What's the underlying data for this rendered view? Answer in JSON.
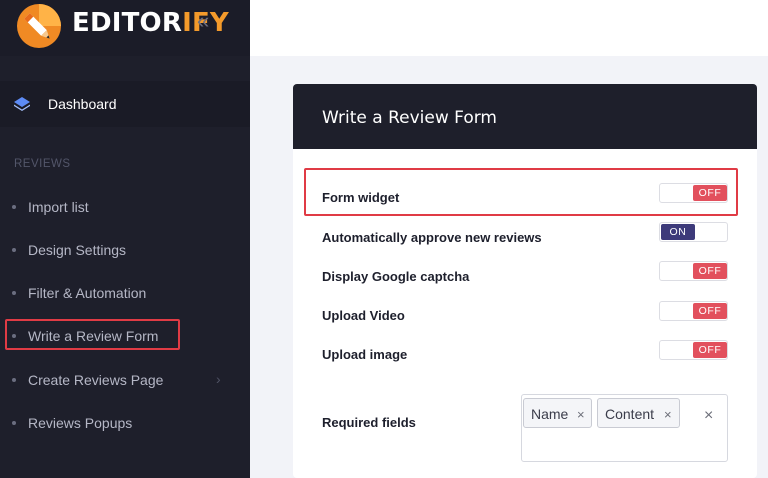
{
  "brand": {
    "name_main": "EDITOR",
    "name_accent": "IFY",
    "collapse_icon": "chevrons-left-icon",
    "accent_color": "#f39a2b"
  },
  "sidebar": {
    "dashboard_label": "Dashboard",
    "section_title": "REVIEWS",
    "items": [
      {
        "label": "Import list"
      },
      {
        "label": "Design Settings"
      },
      {
        "label": "Filter & Automation"
      },
      {
        "label": "Write a Review Form"
      },
      {
        "label": "Create Reviews Page"
      },
      {
        "label": "Reviews Popups"
      }
    ]
  },
  "card": {
    "title": "Write a Review Form",
    "settings": [
      {
        "label": "Form widget",
        "state": "OFF"
      },
      {
        "label": "Automatically approve new reviews",
        "state": "ON"
      },
      {
        "label": "Display Google captcha",
        "state": "OFF"
      },
      {
        "label": "Upload Video",
        "state": "OFF"
      },
      {
        "label": "Upload image",
        "state": "OFF"
      }
    ],
    "required_fields": {
      "label": "Required fields",
      "tags": [
        "Name",
        "Content"
      ],
      "remove_glyph": "×",
      "clear_glyph": "×"
    }
  },
  "colors": {
    "off": "#e2505d",
    "on": "#3d3a7a",
    "highlight": "#e03b45",
    "sidebar_bg": "#1e1f2b"
  }
}
